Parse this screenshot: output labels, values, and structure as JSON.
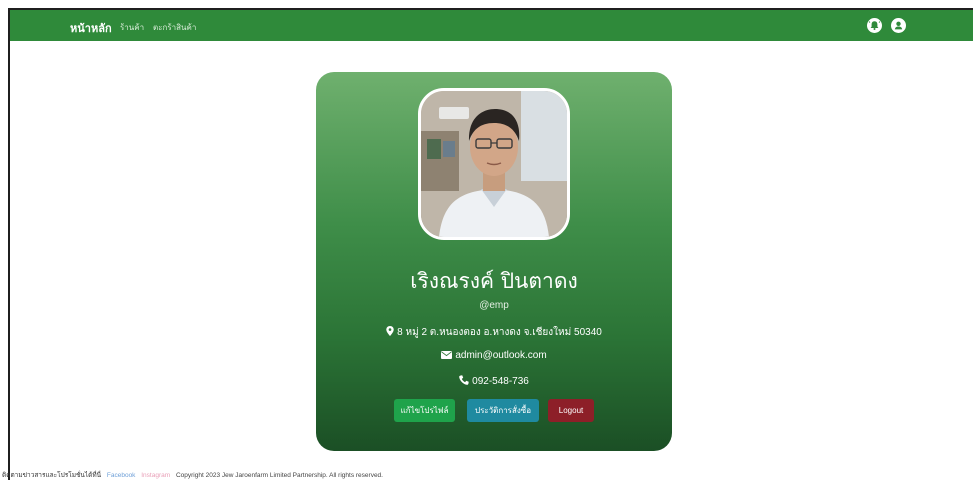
{
  "navbar": {
    "home_label": "หน้าหลัก",
    "shop_label": "ร้านค้า",
    "cart_label": "ตะกร้าสินค้า",
    "color": "#2f8a3a",
    "icons": [
      "bell-icon",
      "user-icon"
    ]
  },
  "profile": {
    "name": "เริงณรงค์ ปินตาดง",
    "username": "@emp",
    "address": "8 หมู่ 2 ต.หนองตอง อ.หางดง จ.เชียงใหม่ 50340",
    "email": "admin@outlook.com",
    "phone": "092-548-736",
    "icons": [
      "map-marker-icon",
      "envelope-icon",
      "phone-icon"
    ]
  },
  "buttons": {
    "edit_label": "แก้ไขโปรไฟล์",
    "history_label": "ประวัติการสั่งซื้อ",
    "logout_label": "Logout",
    "edit_color": "#1fa34b",
    "history_color": "#1f8aa0",
    "logout_color": "#8d1f28"
  },
  "footer": {
    "contact_label": "ติดตามข่าวสารและโปรโมชั่นได้ที่นี่",
    "facebook_label": "Facebook",
    "instagram_label": "Instagram",
    "copyright": "Copyright 2023 Jew Jaroenfarm Limited Partnership. All rights reserved."
  }
}
